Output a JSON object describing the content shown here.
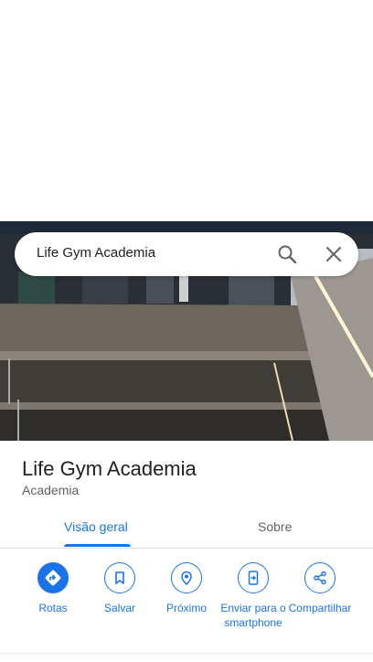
{
  "search": {
    "query": "Life Gym Academia"
  },
  "place": {
    "name": "Life Gym Academia",
    "category": "Academia"
  },
  "tabs": [
    {
      "label": "Visão geral",
      "active": true
    },
    {
      "label": "Sobre",
      "active": false
    }
  ],
  "actions": [
    {
      "label": "Rotas",
      "icon": "directions-icon"
    },
    {
      "label": "Salvar",
      "icon": "bookmark-icon"
    },
    {
      "label": "Próximo",
      "icon": "nearby-icon"
    },
    {
      "label": "Enviar para o smartphone",
      "icon": "send-to-phone-icon"
    },
    {
      "label": "Compartilhar",
      "icon": "share-icon"
    }
  ],
  "colors": {
    "accent": "#1a73e8",
    "text": "#202124",
    "secondary": "#5f6368"
  }
}
